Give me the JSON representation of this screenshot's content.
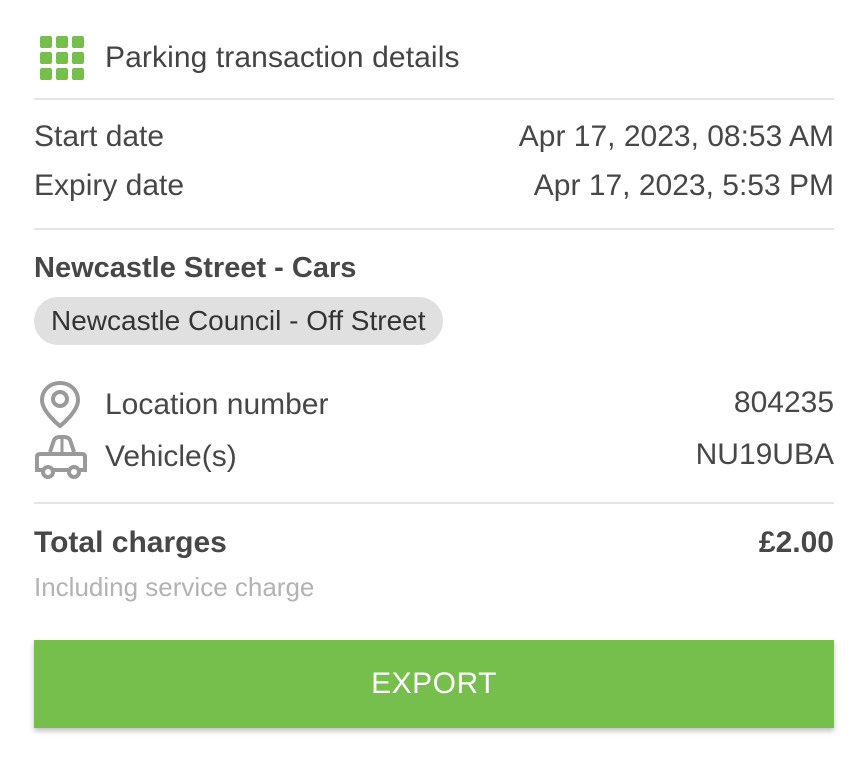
{
  "header": {
    "title": "Parking transaction details",
    "icon": "grid-icon",
    "icon_color": "#76bf4c"
  },
  "dates": {
    "start_label": "Start date",
    "start_value": "Apr 17, 2023, 08:53 AM",
    "expiry_label": "Expiry date",
    "expiry_value": "Apr 17, 2023, 5:53 PM"
  },
  "zone": {
    "name": "Newcastle Street - Cars",
    "operator": "Newcastle Council - Off Street"
  },
  "details": {
    "location_icon": "location-pin-icon",
    "location_label": "Location number",
    "location_value": "804235",
    "vehicle_icon": "car-icon",
    "vehicle_label": "Vehicle(s)",
    "vehicle_value": "NU19UBA"
  },
  "charges": {
    "total_label": "Total charges",
    "total_value": "£2.00",
    "note": "Including service charge"
  },
  "actions": {
    "export_label": "EXPORT"
  },
  "colors": {
    "accent": "#76bf4c",
    "text": "#474747",
    "muted": "#b3b3b3",
    "chip_bg": "#e0e0e0",
    "divider": "#e3e3e3"
  }
}
